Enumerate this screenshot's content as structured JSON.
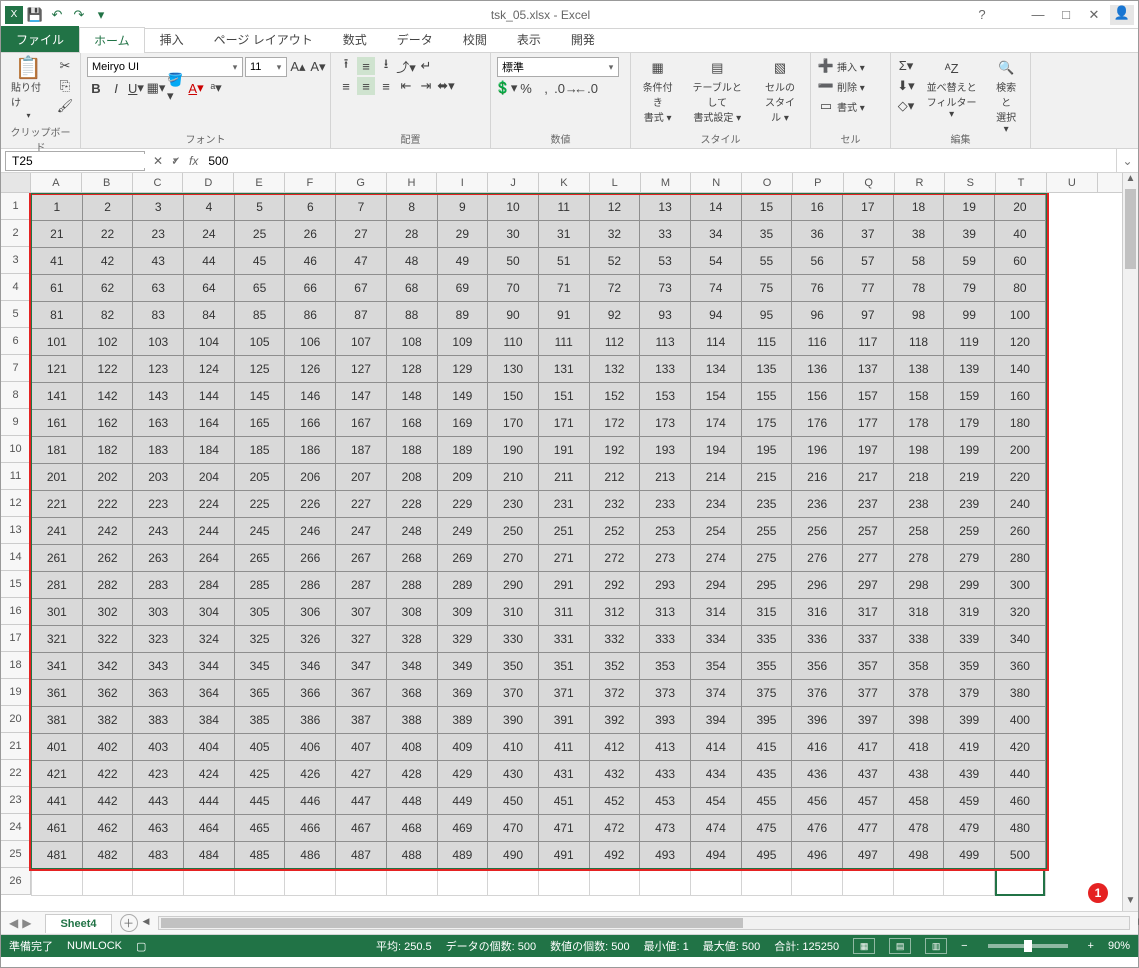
{
  "app": {
    "title": "tsk_05.xlsx - Excel"
  },
  "qat": {
    "save": "💾",
    "undo": "↶",
    "redo": "↷"
  },
  "win": {
    "help": "?",
    "opts": "⬚",
    "min": "—",
    "max": "□",
    "close": "✕"
  },
  "tabs": {
    "file": "ファイル",
    "home": "ホーム",
    "insert": "挿入",
    "layout": "ページ レイアウト",
    "formula": "数式",
    "data": "データ",
    "review": "校閲",
    "view": "表示",
    "dev": "開発"
  },
  "ribbon": {
    "clipboard": {
      "label": "クリップボード",
      "paste": "貼り付け"
    },
    "font": {
      "label": "フォント",
      "name": "Meiryo UI",
      "size": "11"
    },
    "align": {
      "label": "配置"
    },
    "number": {
      "label": "数値",
      "style": "標準"
    },
    "styles": {
      "label": "スタイル",
      "cond": "条件付き\n書式 ▾",
      "table": "テーブルとして\n書式設定 ▾",
      "cell": "セルの\nスタイル ▾"
    },
    "cells": {
      "label": "セル",
      "insert": "挿入 ▾",
      "delete": "削除 ▾",
      "format": "書式 ▾"
    },
    "edit": {
      "label": "編集",
      "sort": "並べ替えと\nフィルター ▾",
      "find": "検索と\n選択 ▾"
    }
  },
  "namebox": "T25",
  "formula": "500",
  "columns": [
    "A",
    "B",
    "C",
    "D",
    "E",
    "F",
    "G",
    "H",
    "I",
    "J",
    "K",
    "L",
    "M",
    "N",
    "O",
    "P",
    "Q",
    "R",
    "S",
    "T",
    "U"
  ],
  "grid": {
    "rows": 25,
    "cols": 20
  },
  "callout": "1",
  "sheet_tab": "Sheet4",
  "status": {
    "ready": "準備完了",
    "numlock": "NUMLOCK",
    "avg": "平均: 250.5",
    "count": "データの個数: 500",
    "numcount": "数値の個数: 500",
    "min": "最小値: 1",
    "max": "最大値: 500",
    "sum": "合計: 125250",
    "zoom": "90%"
  },
  "chart_data": {
    "type": "table",
    "title": "Numeric grid 1–500 (20 columns × 25 rows)",
    "columns": [
      "A",
      "B",
      "C",
      "D",
      "E",
      "F",
      "G",
      "H",
      "I",
      "J",
      "K",
      "L",
      "M",
      "N",
      "O",
      "P",
      "Q",
      "R",
      "S",
      "T"
    ],
    "row_labels": [
      1,
      2,
      3,
      4,
      5,
      6,
      7,
      8,
      9,
      10,
      11,
      12,
      13,
      14,
      15,
      16,
      17,
      18,
      19,
      20,
      21,
      22,
      23,
      24,
      25
    ],
    "rows": [
      [
        1,
        2,
        3,
        4,
        5,
        6,
        7,
        8,
        9,
        10,
        11,
        12,
        13,
        14,
        15,
        16,
        17,
        18,
        19,
        20
      ],
      [
        21,
        22,
        23,
        24,
        25,
        26,
        27,
        28,
        29,
        30,
        31,
        32,
        33,
        34,
        35,
        36,
        37,
        38,
        39,
        40
      ],
      [
        41,
        42,
        43,
        44,
        45,
        46,
        47,
        48,
        49,
        50,
        51,
        52,
        53,
        54,
        55,
        56,
        57,
        58,
        59,
        60
      ],
      [
        61,
        62,
        63,
        64,
        65,
        66,
        67,
        68,
        69,
        70,
        71,
        72,
        73,
        74,
        75,
        76,
        77,
        78,
        79,
        80
      ],
      [
        81,
        82,
        83,
        84,
        85,
        86,
        87,
        88,
        89,
        90,
        91,
        92,
        93,
        94,
        95,
        96,
        97,
        98,
        99,
        100
      ],
      [
        101,
        102,
        103,
        104,
        105,
        106,
        107,
        108,
        109,
        110,
        111,
        112,
        113,
        114,
        115,
        116,
        117,
        118,
        119,
        120
      ],
      [
        121,
        122,
        123,
        124,
        125,
        126,
        127,
        128,
        129,
        130,
        131,
        132,
        133,
        134,
        135,
        136,
        137,
        138,
        139,
        140
      ],
      [
        141,
        142,
        143,
        144,
        145,
        146,
        147,
        148,
        149,
        150,
        151,
        152,
        153,
        154,
        155,
        156,
        157,
        158,
        159,
        160
      ],
      [
        161,
        162,
        163,
        164,
        165,
        166,
        167,
        168,
        169,
        170,
        171,
        172,
        173,
        174,
        175,
        176,
        177,
        178,
        179,
        180
      ],
      [
        181,
        182,
        183,
        184,
        185,
        186,
        187,
        188,
        189,
        190,
        191,
        192,
        193,
        194,
        195,
        196,
        197,
        198,
        199,
        200
      ],
      [
        201,
        202,
        203,
        204,
        205,
        206,
        207,
        208,
        209,
        210,
        211,
        212,
        213,
        214,
        215,
        216,
        217,
        218,
        219,
        220
      ],
      [
        221,
        222,
        223,
        224,
        225,
        226,
        227,
        228,
        229,
        230,
        231,
        232,
        233,
        234,
        235,
        236,
        237,
        238,
        239,
        240
      ],
      [
        241,
        242,
        243,
        244,
        245,
        246,
        247,
        248,
        249,
        250,
        251,
        252,
        253,
        254,
        255,
        256,
        257,
        258,
        259,
        260
      ],
      [
        261,
        262,
        263,
        264,
        265,
        266,
        267,
        268,
        269,
        270,
        271,
        272,
        273,
        274,
        275,
        276,
        277,
        278,
        279,
        280
      ],
      [
        281,
        282,
        283,
        284,
        285,
        286,
        287,
        288,
        289,
        290,
        291,
        292,
        293,
        294,
        295,
        296,
        297,
        298,
        299,
        300
      ],
      [
        301,
        302,
        303,
        304,
        305,
        306,
        307,
        308,
        309,
        310,
        311,
        312,
        313,
        314,
        315,
        316,
        317,
        318,
        319,
        320
      ],
      [
        321,
        322,
        323,
        324,
        325,
        326,
        327,
        328,
        329,
        330,
        331,
        332,
        333,
        334,
        335,
        336,
        337,
        338,
        339,
        340
      ],
      [
        341,
        342,
        343,
        344,
        345,
        346,
        347,
        348,
        349,
        350,
        351,
        352,
        353,
        354,
        355,
        356,
        357,
        358,
        359,
        360
      ],
      [
        361,
        362,
        363,
        364,
        365,
        366,
        367,
        368,
        369,
        370,
        371,
        372,
        373,
        374,
        375,
        376,
        377,
        378,
        379,
        380
      ],
      [
        381,
        382,
        383,
        384,
        385,
        386,
        387,
        388,
        389,
        390,
        391,
        392,
        393,
        394,
        395,
        396,
        397,
        398,
        399,
        400
      ],
      [
        401,
        402,
        403,
        404,
        405,
        406,
        407,
        408,
        409,
        410,
        411,
        412,
        413,
        414,
        415,
        416,
        417,
        418,
        419,
        420
      ],
      [
        421,
        422,
        423,
        424,
        425,
        426,
        427,
        428,
        429,
        430,
        431,
        432,
        433,
        434,
        435,
        436,
        437,
        438,
        439,
        440
      ],
      [
        441,
        442,
        443,
        444,
        445,
        446,
        447,
        448,
        449,
        450,
        451,
        452,
        453,
        454,
        455,
        456,
        457,
        458,
        459,
        460
      ],
      [
        461,
        462,
        463,
        464,
        465,
        466,
        467,
        468,
        469,
        470,
        471,
        472,
        473,
        474,
        475,
        476,
        477,
        478,
        479,
        480
      ],
      [
        481,
        482,
        483,
        484,
        485,
        486,
        487,
        488,
        489,
        490,
        491,
        492,
        493,
        494,
        495,
        496,
        497,
        498,
        499,
        500
      ]
    ]
  }
}
